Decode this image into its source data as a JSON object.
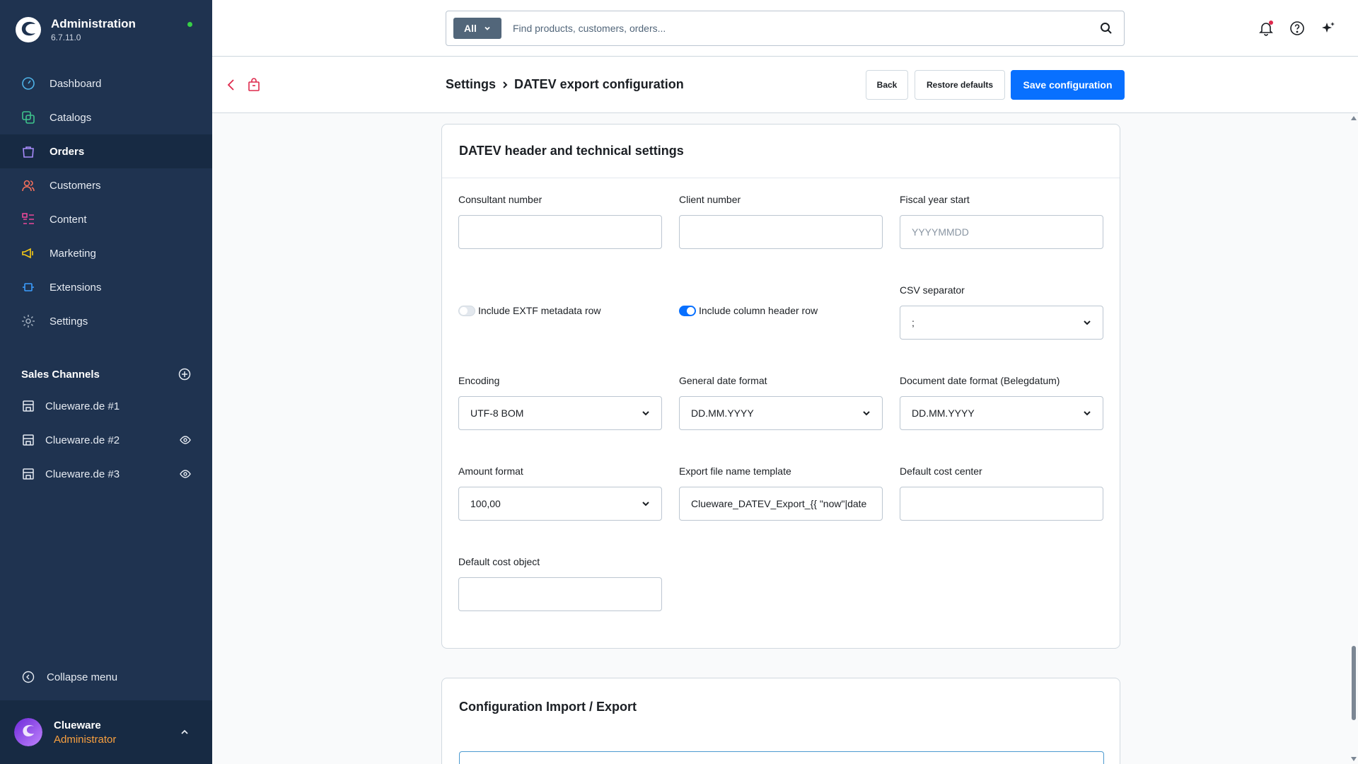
{
  "app": {
    "title": "Administration",
    "version": "6.7.11.0"
  },
  "nav": [
    {
      "label": "Dashboard",
      "icon": "dashboard-icon"
    },
    {
      "label": "Catalogs",
      "icon": "catalogs-icon"
    },
    {
      "label": "Orders",
      "icon": "orders-icon",
      "active": true
    },
    {
      "label": "Customers",
      "icon": "customers-icon"
    },
    {
      "label": "Content",
      "icon": "content-icon"
    },
    {
      "label": "Marketing",
      "icon": "marketing-icon"
    },
    {
      "label": "Extensions",
      "icon": "extensions-icon"
    },
    {
      "label": "Settings",
      "icon": "settings-icon"
    }
  ],
  "sales_channels": {
    "heading": "Sales Channels",
    "items": [
      {
        "label": "Clueware.de #1",
        "visible_icon": false
      },
      {
        "label": "Clueware.de #2",
        "visible_icon": true
      },
      {
        "label": "Clueware.de #3",
        "visible_icon": true
      }
    ]
  },
  "collapse_label": "Collapse menu",
  "user": {
    "name": "Clueware",
    "role": "Administrator"
  },
  "search": {
    "scope": "All",
    "placeholder": "Find products, customers, orders..."
  },
  "breadcrumb": {
    "parent": "Settings",
    "current": "DATEV export configuration"
  },
  "buttons": {
    "back": "Back",
    "restore": "Restore defaults",
    "save": "Save configuration"
  },
  "section1": {
    "title": "DATEV header and technical settings",
    "consultant_number": {
      "label": "Consultant number",
      "value": ""
    },
    "client_number": {
      "label": "Client number",
      "value": ""
    },
    "fiscal_year_start": {
      "label": "Fiscal year start",
      "placeholder": "YYYYMMDD"
    },
    "extf_toggle": {
      "label": "Include EXTF metadata row",
      "enabled": false
    },
    "header_toggle": {
      "label": "Include column header row",
      "enabled": true
    },
    "csv_separator": {
      "label": "CSV separator",
      "value": ";"
    },
    "encoding": {
      "label": "Encoding",
      "value": "UTF-8 BOM"
    },
    "general_date_format": {
      "label": "General date format",
      "value": "DD.MM.YYYY"
    },
    "document_date_format": {
      "label": "Document date format (Belegdatum)",
      "value": "DD.MM.YYYY"
    },
    "amount_format": {
      "label": "Amount format",
      "value": "100,00"
    },
    "export_file_name": {
      "label": "Export file name template",
      "value": "Clueware_DATEV_Export_{{ \"now\"|date"
    },
    "default_cost_center": {
      "label": "Default cost center",
      "value": ""
    },
    "default_cost_object": {
      "label": "Default cost object",
      "value": ""
    }
  },
  "section2": {
    "title": "Configuration Import / Export"
  },
  "colors": {
    "sidebar": "#1f3350",
    "primary": "#0870ff",
    "accent_role": "#f9a03f",
    "status": "#37d046"
  }
}
